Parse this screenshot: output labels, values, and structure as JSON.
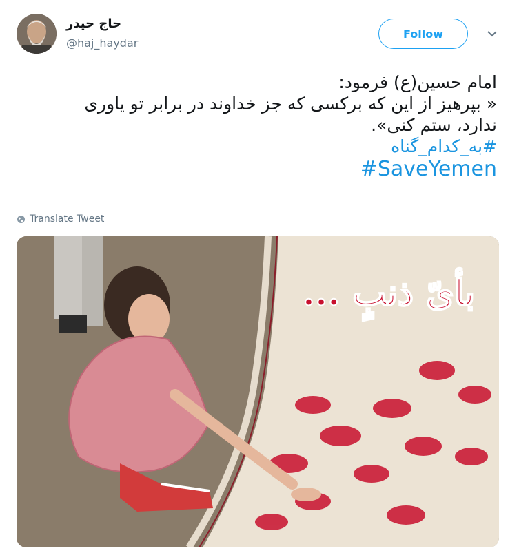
{
  "user": {
    "display_name": "حاج حیدر",
    "handle": "@haj_haydar"
  },
  "actions": {
    "follow_label": "Follow"
  },
  "tweet": {
    "lines": [
      "امام حسین(ع) فرمود:",
      "« بپرهیز از این که برکسی که جز خداوند در برابر تو یاوری",
      "ندارد، ستم کنی»."
    ],
    "hashtags": [
      "#به_کدام_گناه",
      "#SaveYemen"
    ]
  },
  "translate_label": "Translate Tweet",
  "media": {
    "overlay_text": "بأیّ ذنبٍ ..."
  },
  "colors": {
    "accent": "#1da1f2",
    "hashtag": "#1b95e0",
    "muted": "#657786",
    "blood_red": "#c8102e"
  },
  "icons": [
    "avatar-image",
    "chevron-down-icon",
    "globe-icon"
  ]
}
